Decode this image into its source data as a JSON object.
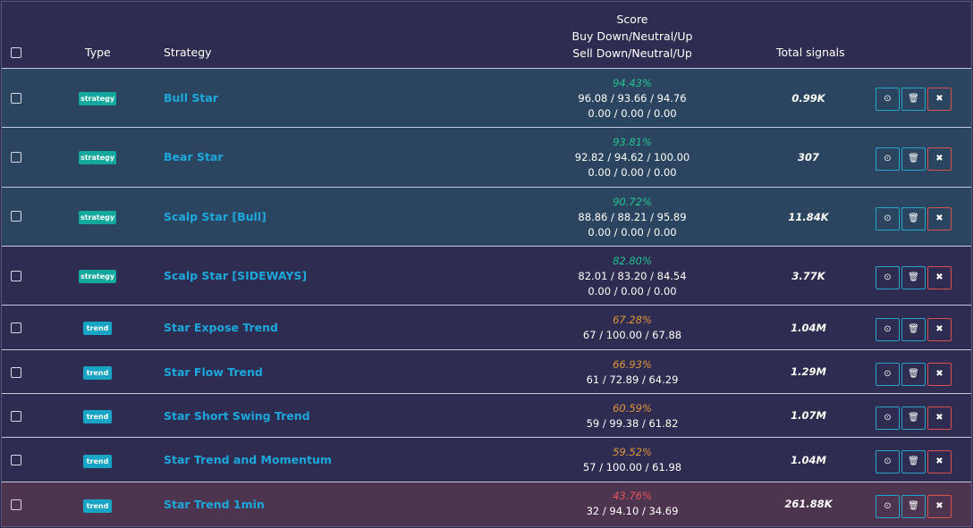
{
  "header": {
    "type": "Type",
    "strategy": "Strategy",
    "score_line1": "Score",
    "score_line2": "Buy Down/Neutral/Up",
    "score_line3": "Sell Down/Neutral/Up",
    "total": "Total signals"
  },
  "colors": {
    "green_pct": "#23c48e",
    "orange_pct": "#e0953a",
    "red_pct": "#e8545a",
    "name": "#1ca8dc"
  },
  "rows": [
    {
      "type": "strategy",
      "name": "Bull Star",
      "pct": "94.43%",
      "buy": "96.08 / 93.66 / 94.76",
      "sell": "0.00 / 0.00 / 0.00",
      "total": "0.99K",
      "tone": "green"
    },
    {
      "type": "strategy",
      "name": "Bear Star",
      "pct": "93.81%",
      "buy": "92.82 / 94.62 / 100.00",
      "sell": "0.00 / 0.00 / 0.00",
      "total": "307",
      "tone": "green"
    },
    {
      "type": "strategy",
      "name": "Scalp Star [Bull]",
      "pct": "90.72%",
      "buy": "88.86 / 88.21 / 95.89",
      "sell": "0.00 / 0.00 / 0.00",
      "total": "11.84K",
      "tone": "green"
    },
    {
      "type": "strategy",
      "name": "Scalp Star [SIDEWAYS]",
      "pct": "82.80%",
      "buy": "82.01 / 83.20 / 84.54",
      "sell": "0.00 / 0.00 / 0.00",
      "total": "3.77K",
      "tone": "purple"
    },
    {
      "type": "trend",
      "name": "Star Expose Trend",
      "pct": "67.28%",
      "buy": "67 / 100.00 / 67.88",
      "total": "1.04M",
      "tone": "purple"
    },
    {
      "type": "trend",
      "name": "Star Flow Trend",
      "pct": "66.93%",
      "buy": "61 / 72.89 / 64.29",
      "total": "1.29M",
      "tone": "purple"
    },
    {
      "type": "trend",
      "name": "Star Short Swing Trend",
      "pct": "60.59%",
      "buy": "59 / 99.38 / 61.82",
      "total": "1.07M",
      "tone": "purple"
    },
    {
      "type": "trend",
      "name": "Star Trend and Momentum",
      "pct": "59.52%",
      "buy": "57 / 100.00 / 61.98",
      "total": "1.04M",
      "tone": "purple"
    },
    {
      "type": "trend",
      "name": "Star Trend 1min",
      "pct": "43.76%",
      "buy": "32 / 94.10 / 34.69",
      "total": "261.88K",
      "tone": "red"
    }
  ],
  "icons": {
    "view": "target-icon",
    "delete": "trash-icon",
    "remove": "close-icon"
  }
}
